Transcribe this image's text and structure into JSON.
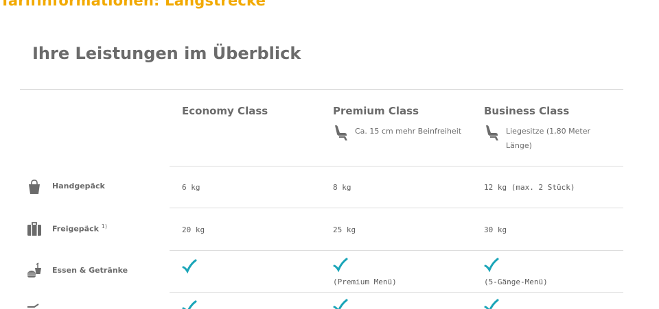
{
  "banner": {
    "title": "Tarifinformationen: Langstrecke"
  },
  "section": {
    "title": "Ihre Leistungen im Überblick"
  },
  "classes": [
    {
      "name": "Economy Class",
      "note": ""
    },
    {
      "name": "Premium Class",
      "note": "Ca. 15 cm mehr Beinfreiheit"
    },
    {
      "name": "Business Class",
      "note": "Liegesitze (1,80 Meter Länge)"
    }
  ],
  "rows": [
    {
      "label": "Handgepäck",
      "sup": "",
      "icon": "bag-icon",
      "values": [
        "6 kg",
        "8 kg",
        "12 kg (max. 2 Stück)"
      ]
    },
    {
      "label": "Freigepäck",
      "sup": "1)",
      "icon": "suitcase-icon",
      "values": [
        "20 kg",
        "25 kg",
        "30 kg"
      ]
    },
    {
      "label": "Essen & Getränke",
      "sup": "",
      "icon": "food-drink-icon",
      "values": [
        "",
        "(Premium Menü)",
        "(5-Gänge-Menü)"
      ]
    }
  ],
  "colors": {
    "accent": "#f2a900",
    "check": "#1aa5b8",
    "text": "#6b6b6b",
    "divider": "#dcdcdc"
  }
}
